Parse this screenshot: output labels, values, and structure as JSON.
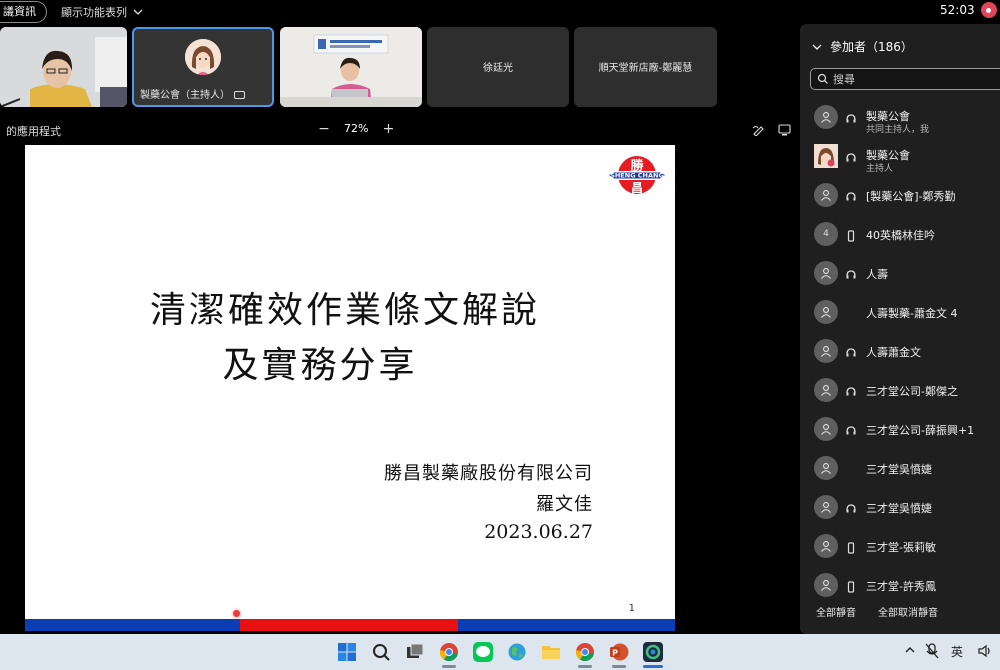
{
  "topbar": {
    "meeting_info_label": "議資訊",
    "view_menu_label": "顯示功能表列",
    "clock": "52:03"
  },
  "video_tiles": [
    {
      "name": ""
    },
    {
      "name": "製藥公會（主持人）"
    },
    {
      "name": ""
    },
    {
      "name": "徐廷光"
    },
    {
      "name": "順天堂新店廠-鄭麗慧"
    }
  ],
  "sharebar": {
    "label": "的應用程式",
    "zoom_level": "72%"
  },
  "slide": {
    "title_line1": "清潔確效作業條文解說",
    "title_line2": "及實務分享",
    "company": "勝昌製藥廠股份有限公司",
    "presenter": "羅文佳",
    "date": "2023.06.27",
    "page_number": "1",
    "logo_text_top": "勝",
    "logo_band": "SHENG CHANG",
    "logo_text_bottom": "昌",
    "stripe_colors": [
      "#0d3db5",
      "#e81010",
      "#0d3db5"
    ]
  },
  "participants": {
    "header": "參加者（186）",
    "search_placeholder": "搜尋",
    "list": [
      {
        "name": "製藥公會",
        "sub": "共同主持人，我",
        "avatar": "person-icon",
        "device": "headset-icon"
      },
      {
        "name": "製藥公會",
        "sub": "主持人",
        "avatar": "photo",
        "device": "headset-icon"
      },
      {
        "name": "[製藥公會]-鄭秀勤",
        "sub": "",
        "avatar": "person-icon",
        "device": "headset-icon"
      },
      {
        "name": "40英橋林佳吟",
        "sub": "",
        "avatar": "4",
        "device": "phone-icon"
      },
      {
        "name": "人壽",
        "sub": "",
        "avatar": "person-icon",
        "device": "headset-icon"
      },
      {
        "name": "人壽製藥-蕭金文 4",
        "sub": "",
        "avatar": "person-icon",
        "device": ""
      },
      {
        "name": "人壽蕭金文",
        "sub": "",
        "avatar": "person-icon",
        "device": "headset-icon"
      },
      {
        "name": "三才堂公司-鄭傑之",
        "sub": "",
        "avatar": "person-icon",
        "device": "headset-icon"
      },
      {
        "name": "三才堂公司-薛振興+1",
        "sub": "",
        "avatar": "person-icon",
        "device": "headset-icon"
      },
      {
        "name": "三才堂吳憤婕",
        "sub": "",
        "avatar": "person-icon",
        "device": ""
      },
      {
        "name": "三才堂吳憤婕",
        "sub": "",
        "avatar": "person-icon",
        "device": "headset-icon"
      },
      {
        "name": "三才堂-張莉敏",
        "sub": "",
        "avatar": "person-icon",
        "device": "phone-icon"
      },
      {
        "name": "三才堂-許秀鳳",
        "sub": "",
        "avatar": "person-icon",
        "device": "phone-icon"
      }
    ],
    "mute_all_label": "全部靜音",
    "unmute_all_label": "全部取消靜音"
  },
  "taskbar": {
    "ime_label": "英",
    "icons": [
      "windows-start-icon",
      "search-icon",
      "task-view-icon",
      "chrome-icon",
      "line-icon",
      "globe-icon",
      "file-explorer-icon",
      "chrome-icon",
      "powerpoint-icon",
      "webex-icon"
    ]
  }
}
